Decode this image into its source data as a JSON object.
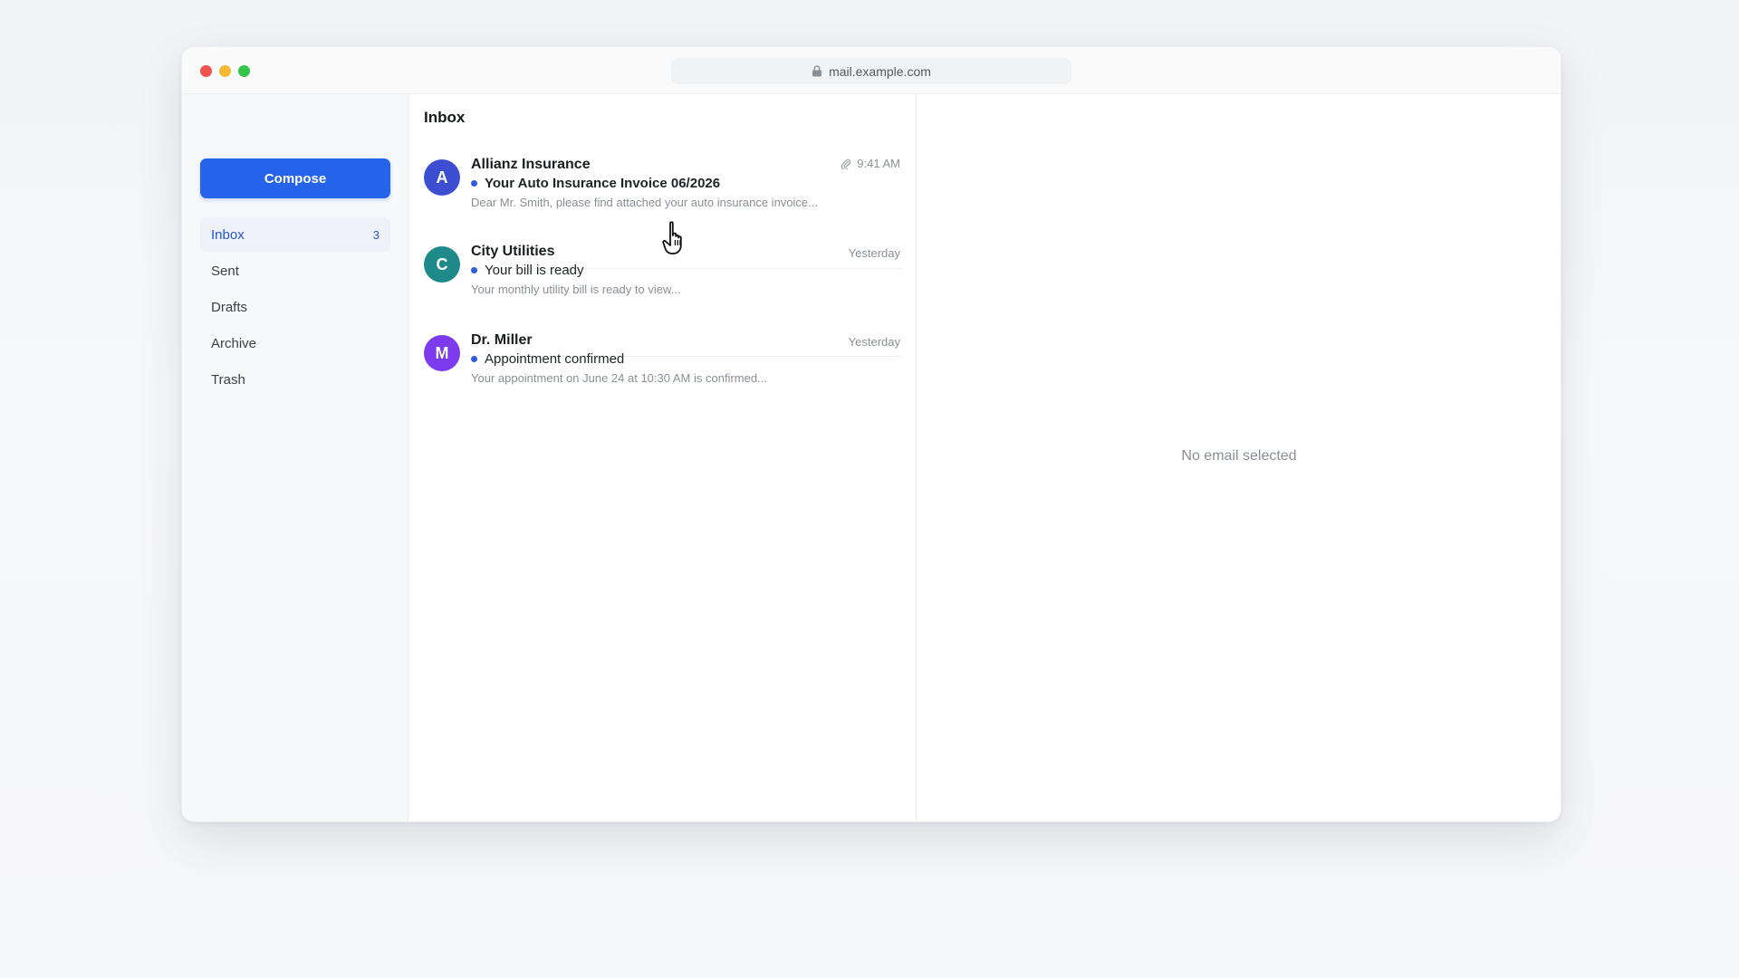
{
  "browser": {
    "url": "mail.example.com",
    "lock_icon": "lock-icon"
  },
  "sidebar": {
    "compose_label": "Compose",
    "items": [
      {
        "label": "Inbox",
        "count": "3",
        "active": true
      },
      {
        "label": "Sent",
        "count": ""
      },
      {
        "label": "Drafts",
        "count": ""
      },
      {
        "label": "Archive",
        "count": ""
      },
      {
        "label": "Trash",
        "count": ""
      }
    ]
  },
  "list": {
    "title": "Inbox",
    "emails": [
      {
        "avatar_letter": "A",
        "avatar_color": "#3d4fd0",
        "sender": "Allianz Insurance",
        "subject": "Your Auto Insurance Invoice 06/2026",
        "preview": "Dear Mr. Smith, please find attached your auto insurance invoice...",
        "time": "9:41 AM",
        "has_attachment": true
      },
      {
        "avatar_letter": "C",
        "avatar_color": "#1f8a8a",
        "sender": "City Utilities",
        "subject": "Your bill is ready",
        "preview": "Your monthly utility bill is ready to view...",
        "time": "Yesterday",
        "has_attachment": false
      },
      {
        "avatar_letter": "M",
        "avatar_color": "#7c3aed",
        "sender": "Dr. Miller",
        "subject": "Appointment confirmed",
        "preview": "Your appointment on June 24 at 10:30 AM is confirmed...",
        "time": "Yesterday",
        "has_attachment": false
      }
    ]
  },
  "reader": {
    "empty_message": "No email selected"
  },
  "colors": {
    "accent": "#2563eb",
    "unread": "#2f5ce0"
  }
}
